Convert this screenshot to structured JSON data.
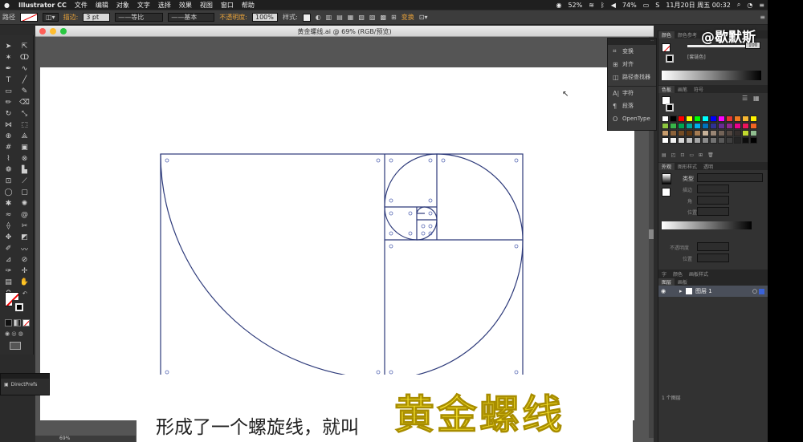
{
  "menubar": {
    "apple": "",
    "app": "Illustrator CC",
    "menus": [
      "文件",
      "编辑",
      "对象",
      "文字",
      "选择",
      "效果",
      "视图",
      "窗口",
      "帮助"
    ],
    "battery": "52%",
    "battery2": "74%",
    "clock": "11月20日 周五  00:32"
  },
  "control": {
    "selection_label": "路径",
    "stroke_label": "描边:",
    "stroke_value": "3 pt",
    "profile_label": "等比",
    "brush_label": "基本",
    "opacity_label": "不透明度:",
    "opacity_value": "100%",
    "style_label": "样式:",
    "transform_label": "变换"
  },
  "document": {
    "title": "黄金螺线.ai @ 69% (RGB/预览)",
    "zoom": "69%"
  },
  "floatpanel": {
    "items": [
      {
        "icon": "transform-icon",
        "label": "变换"
      },
      {
        "icon": "align-icon",
        "label": "对齐"
      },
      {
        "icon": "pathfinder-icon",
        "label": "路径查找器"
      },
      {
        "icon": "character-icon",
        "label": "字符"
      },
      {
        "icon": "paragraph-icon",
        "label": "段落"
      },
      {
        "icon": "opentype-icon",
        "label": "OpenType"
      }
    ]
  },
  "panels": {
    "tabs_top": [
      "颜色",
      "颜色参考"
    ],
    "color_mode": "[套链色]",
    "color_value": "100",
    "tabs_swatch": [
      "色板",
      "画笔",
      "符号"
    ],
    "tabs_appearance": [
      "外观",
      "图形样式",
      "透明"
    ],
    "type_label": "类型",
    "stroke_small": "描边",
    "angle": "角",
    "location": "位置",
    "opacity": "不透明度",
    "position": "位置",
    "tabs_layers": [
      "图层",
      "画板"
    ],
    "tabs_layers2": [
      "字",
      "颜色",
      "画板样式"
    ],
    "layer_name": "图层 1",
    "layer_count": "1 个图层"
  },
  "swatch_colors": [
    "#ffffff",
    "#000000",
    "#ff0000",
    "#ffff00",
    "#00ff00",
    "#00ffff",
    "#0000ff",
    "#ff00ff",
    "#e8392f",
    "#ee7b22",
    "#f7b733",
    "#fff200",
    "#8dc63f",
    "#39b54a",
    "#00a651",
    "#00a99d",
    "#00aeef",
    "#0072bc",
    "#2e3192",
    "#662d91",
    "#92278f",
    "#ec008c",
    "#ed145b",
    "#f26522",
    "#c69c6d",
    "#8c6239",
    "#754c24",
    "#603913",
    "#a67c52",
    "#c7b299",
    "#998675",
    "#736357",
    "#534741",
    "#362f2d",
    "#c1d82f",
    "#8fbc8f",
    "#ffffff",
    "#f2f2f2",
    "#d9d9d9",
    "#bfbfbf",
    "#a6a6a6",
    "#8c8c8c",
    "#737373",
    "#595959",
    "#404040",
    "#262626",
    "#0d0d0d",
    "#000000"
  ],
  "subtitle": {
    "normal": "形成了一个螺旋线，就叫",
    "highlight": "黄金螺线"
  },
  "watermark": "@歇默斯",
  "directprefs": "DirectPrefs",
  "colors": {
    "artwork_stroke": "#2d3a7a",
    "subtitle_yellow": "#f6e22b",
    "ui_dark": "#2d2d2d"
  }
}
